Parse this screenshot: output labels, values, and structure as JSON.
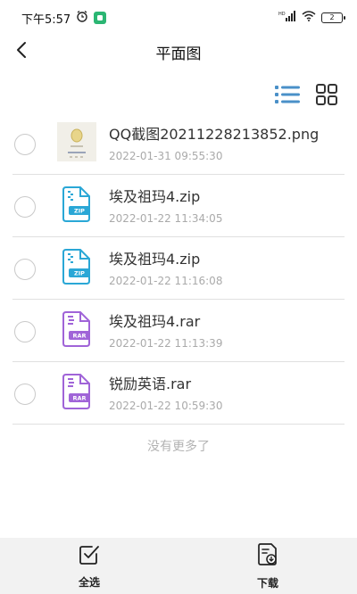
{
  "status_bar": {
    "time": "下午5:57",
    "battery": "2",
    "network": "HD"
  },
  "header": {
    "title": "平面图"
  },
  "view_toggle": {
    "list_icon": "list-view-icon",
    "grid_icon": "grid-view-icon",
    "active_color": "#4a90c8"
  },
  "files": [
    {
      "name": "QQ截图20211228213852.png",
      "time": "2022-01-31 09:55:30",
      "type": "image"
    },
    {
      "name": "埃及祖玛4.zip",
      "time": "2022-01-22 11:34:05",
      "type": "zip",
      "badge": "ZIP"
    },
    {
      "name": "埃及祖玛4.zip",
      "time": "2022-01-22 11:16:08",
      "type": "zip",
      "badge": "ZIP"
    },
    {
      "name": "埃及祖玛4.rar",
      "time": "2022-01-22 11:13:39",
      "type": "rar",
      "badge": "RAR"
    },
    {
      "name": "锐励英语.rar",
      "time": "2022-01-22 10:59:30",
      "type": "rar",
      "badge": "RAR"
    }
  ],
  "list_footer": "没有更多了",
  "bottom_bar": {
    "select_all": "全选",
    "download": "下载"
  },
  "colors": {
    "zip": "#2aa7d6",
    "rar": "#a064d8"
  }
}
